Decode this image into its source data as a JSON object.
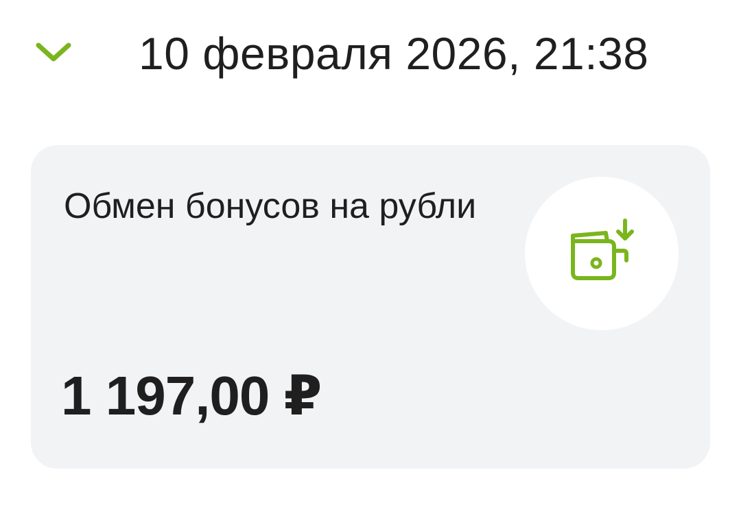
{
  "header": {
    "toggle_icon": "chevron-down-icon",
    "datetime": "10 февраля 2026, 21:38"
  },
  "operation": {
    "title": "Обмен бонусов на рубли",
    "icon": "wallet-download-icon",
    "amount": "1 197,00 ₽"
  },
  "colors": {
    "accent": "#7ab51d",
    "card_background": "#f2f3f5",
    "text": "#1f1f1f"
  }
}
